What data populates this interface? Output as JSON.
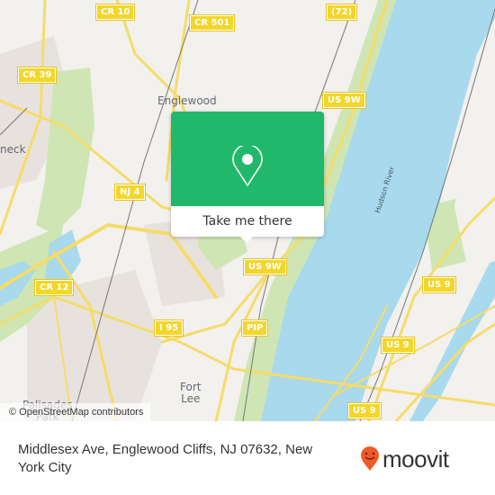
{
  "map": {
    "attribution": "© OpenStreetMap contributors",
    "colors": {
      "land": "#f2f1ee",
      "water": "#a8d9ec",
      "park": "#cfe6b4",
      "urban": "#e8e2de",
      "road": "#f5dc6a",
      "shield": "#f3d629",
      "rail": "#777777"
    },
    "places": [
      {
        "name": "Englewood"
      },
      {
        "name": "neck"
      },
      {
        "name": "Fort\nLee"
      },
      {
        "name": "Palisades\nPark"
      }
    ],
    "water_labels": [
      {
        "name": "Hudson River"
      }
    ],
    "road_shields": [
      {
        "label": "CR 10"
      },
      {
        "label": "CR 501"
      },
      {
        "label": "(72)"
      },
      {
        "label": "CR 39"
      },
      {
        "label": "US 9W"
      },
      {
        "label": "NJ 4"
      },
      {
        "label": "US 9W"
      },
      {
        "label": "CR 12"
      },
      {
        "label": "US 9"
      },
      {
        "label": "I 95"
      },
      {
        "label": "PIP"
      },
      {
        "label": "US 9"
      },
      {
        "label": "US 9"
      }
    ]
  },
  "popup": {
    "icon": "location-pin-icon",
    "button_label": "Take me there",
    "color": "#20b86a"
  },
  "footer": {
    "address": "Middlesex Ave, Englewood Cliffs, NJ 07632, New York City",
    "logo_text": "moovit",
    "logo_color": "#f05a28"
  }
}
